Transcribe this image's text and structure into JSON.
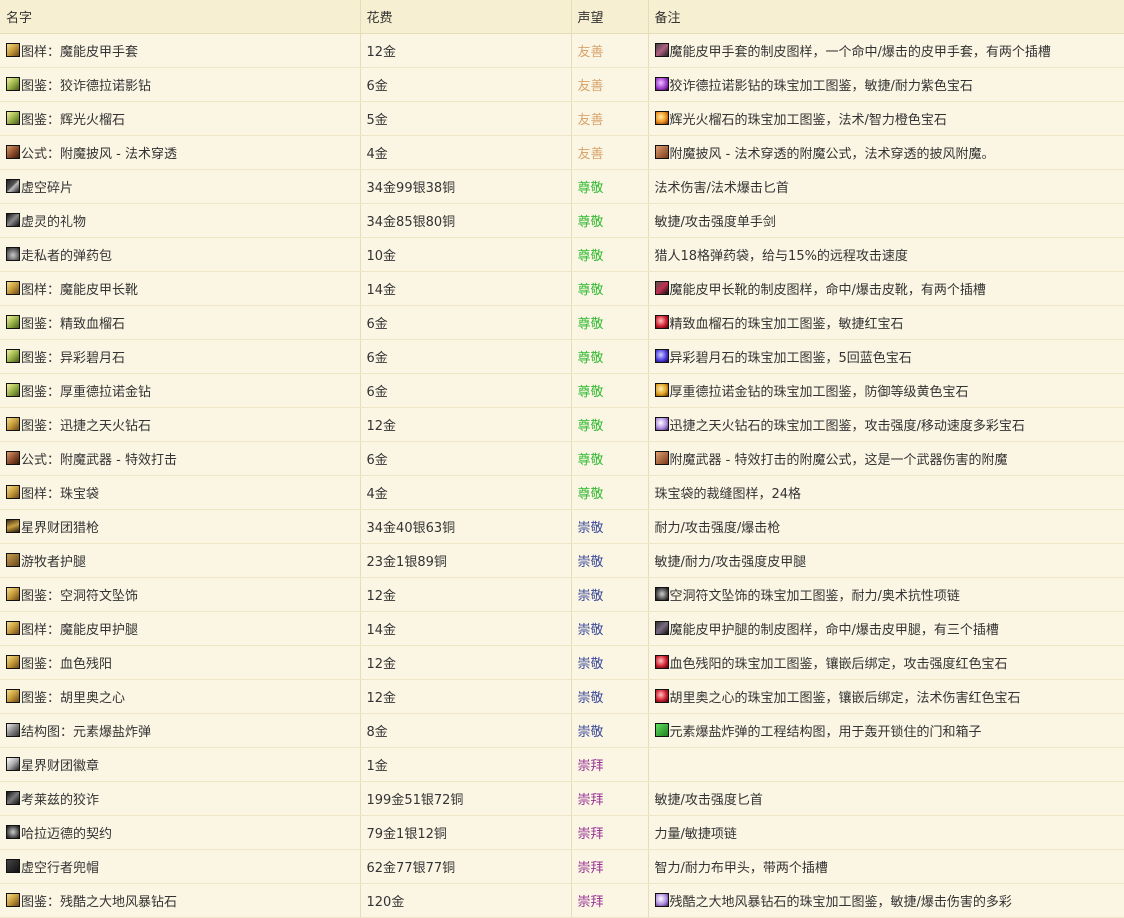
{
  "headers": {
    "name": "名字",
    "cost": "花费",
    "rep": "声望",
    "note": "备注"
  },
  "colors": {
    "friendly": "#d8a46c",
    "honored": "#33bb33",
    "revered": "#3c4a9a",
    "exalted": "#9a3596",
    "background": "#fbf6e4"
  },
  "rows": [
    {
      "icon": "recipe-icon",
      "name": "图样：魔能皮甲手套",
      "cost": "12金",
      "rep": "友善",
      "rep_class": "friendly",
      "note_icon": "gloves-icon",
      "note": "魔能皮甲手套的制皮图样，一个命中/爆击的皮甲手套，有两个插槽"
    },
    {
      "icon": "design-icon",
      "name": "图鉴：狡诈德拉诺影钻",
      "cost": "6金",
      "rep": "友善",
      "rep_class": "friendly",
      "note_icon": "purple-gem-icon",
      "note": "狡诈德拉诺影钻的珠宝加工图鉴，敏捷/耐力紫色宝石"
    },
    {
      "icon": "design-icon",
      "name": "图鉴：辉光火榴石",
      "cost": "5金",
      "rep": "友善",
      "rep_class": "friendly",
      "note_icon": "orange-gem-icon",
      "note": "辉光火榴石的珠宝加工图鉴，法术/智力橙色宝石"
    },
    {
      "icon": "formula-icon",
      "name": "公式：附魔披风 - 法术穿透",
      "cost": "4金",
      "rep": "友善",
      "rep_class": "friendly",
      "note_icon": "cloak-icon",
      "note": "附魔披风 - 法术穿透的附魔公式，法术穿透的披风附魔。"
    },
    {
      "icon": "shard-icon",
      "name": "虚空碎片",
      "cost": "34金99银38铜",
      "rep": "尊敬",
      "rep_class": "honored",
      "note_icon": "",
      "note": "法术伤害/法术爆击匕首"
    },
    {
      "icon": "gift-icon",
      "name": "虚灵的礼物",
      "cost": "34金85银80铜",
      "rep": "尊敬",
      "rep_class": "honored",
      "note_icon": "",
      "note": "敏捷/攻击强度单手剑"
    },
    {
      "icon": "ammo-icon",
      "name": "走私者的弹药包",
      "cost": "10金",
      "rep": "尊敬",
      "rep_class": "honored",
      "note_icon": "",
      "note": "猎人18格弹药袋，给与15%的远程攻击速度"
    },
    {
      "icon": "recipe-icon",
      "name": "图样：魔能皮甲长靴",
      "cost": "14金",
      "rep": "尊敬",
      "rep_class": "honored",
      "note_icon": "boots-icon",
      "note": "魔能皮甲长靴的制皮图样，命中/爆击皮靴，有两个插槽"
    },
    {
      "icon": "design-icon",
      "name": "图鉴：精致血榴石",
      "cost": "6金",
      "rep": "尊敬",
      "rep_class": "honored",
      "note_icon": "red-gem-icon",
      "note": "精致血榴石的珠宝加工图鉴，敏捷红宝石"
    },
    {
      "icon": "design-icon",
      "name": "图鉴：异彩碧月石",
      "cost": "6金",
      "rep": "尊敬",
      "rep_class": "honored",
      "note_icon": "blue-gem-icon",
      "note": "异彩碧月石的珠宝加工图鉴，5回蓝色宝石"
    },
    {
      "icon": "design-icon",
      "name": "图鉴：厚重德拉诺金钻",
      "cost": "6金",
      "rep": "尊敬",
      "rep_class": "honored",
      "note_icon": "yellow-gem-icon",
      "note": "厚重德拉诺金钻的珠宝加工图鉴，防御等级黄色宝石"
    },
    {
      "icon": "recipe-icon",
      "name": "图鉴：迅捷之天火钻石",
      "cost": "12金",
      "rep": "尊敬",
      "rep_class": "honored",
      "note_icon": "prismatic-gem-icon",
      "note": "迅捷之天火钻石的珠宝加工图鉴，攻击强度/移动速度多彩宝石"
    },
    {
      "icon": "formula-icon",
      "name": "公式：附魔武器 - 特效打击",
      "cost": "6金",
      "rep": "尊敬",
      "rep_class": "honored",
      "note_icon": "cloak-icon",
      "note": "附魔武器 - 特效打击的附魔公式，这是一个武器伤害的附魔"
    },
    {
      "icon": "recipe-icon",
      "name": "图样：珠宝袋",
      "cost": "4金",
      "rep": "尊敬",
      "rep_class": "honored",
      "note_icon": "",
      "note": "珠宝袋的裁缝图样，24格"
    },
    {
      "icon": "gun-icon",
      "name": "星界财团猎枪",
      "cost": "34金40银63铜",
      "rep": "崇敬",
      "rep_class": "revered",
      "note_icon": "",
      "note": "耐力/攻击强度/爆击枪"
    },
    {
      "icon": "legs-icon",
      "name": "游牧者护腿",
      "cost": "23金1银89铜",
      "rep": "崇敬",
      "rep_class": "revered",
      "note_icon": "",
      "note": "敏捷/耐力/攻击强度皮甲腿"
    },
    {
      "icon": "recipe-icon",
      "name": "图鉴：空洞符文坠饰",
      "cost": "12金",
      "rep": "崇敬",
      "rep_class": "revered",
      "note_icon": "necklace-icon",
      "note": "空洞符文坠饰的珠宝加工图鉴，耐力/奥术抗性项链"
    },
    {
      "icon": "recipe-icon",
      "name": "图样：魔能皮甲护腿",
      "cost": "14金",
      "rep": "崇敬",
      "rep_class": "revered",
      "note_icon": "pants-icon",
      "note": "魔能皮甲护腿的制皮图样，命中/爆击皮甲腿，有三个插槽"
    },
    {
      "icon": "recipe-icon",
      "name": "图鉴：血色残阳",
      "cost": "12金",
      "rep": "崇敬",
      "rep_class": "revered",
      "note_icon": "red-gem-icon",
      "note": "血色残阳的珠宝加工图鉴，镶嵌后绑定，攻击强度红色宝石"
    },
    {
      "icon": "recipe-icon",
      "name": "图鉴：胡里奥之心",
      "cost": "12金",
      "rep": "崇敬",
      "rep_class": "revered",
      "note_icon": "red-gem-icon",
      "note": "胡里奥之心的珠宝加工图鉴，镶嵌后绑定，法术伤害红色宝石"
    },
    {
      "icon": "schematic-icon",
      "name": "结构图：元素爆盐炸弹",
      "cost": "8金",
      "rep": "崇敬",
      "rep_class": "revered",
      "note_icon": "bomb-icon",
      "note": "元素爆盐炸弹的工程结构图，用于轰开锁住的门和箱子"
    },
    {
      "icon": "badge-icon",
      "name": "星界财团徽章",
      "cost": "1金",
      "rep": "崇拜",
      "rep_class": "exalted",
      "note_icon": "",
      "note": ""
    },
    {
      "icon": "dagger-icon",
      "name": "考莱兹的狡诈",
      "cost": "199金51银72铜",
      "rep": "崇拜",
      "rep_class": "exalted",
      "note_icon": "",
      "note": "敏捷/攻击强度匕首"
    },
    {
      "icon": "necklace-icon",
      "name": "哈拉迈德的契约",
      "cost": "79金1银12铜",
      "rep": "崇拜",
      "rep_class": "exalted",
      "note_icon": "",
      "note": "力量/敏捷项链"
    },
    {
      "icon": "helm-icon",
      "name": "虚空行者兜帽",
      "cost": "62金77银77铜",
      "rep": "崇拜",
      "rep_class": "exalted",
      "note_icon": "",
      "note": "智力/耐力布甲头，带两个插槽"
    },
    {
      "icon": "recipe-icon",
      "name": "图鉴：残酷之大地风暴钻石",
      "cost": "120金",
      "rep": "崇拜",
      "rep_class": "exalted",
      "note_icon": "prismatic-gem-icon",
      "note": "残酷之大地风暴钻石的珠宝加工图鉴，敏捷/爆击伤害的多彩"
    }
  ]
}
